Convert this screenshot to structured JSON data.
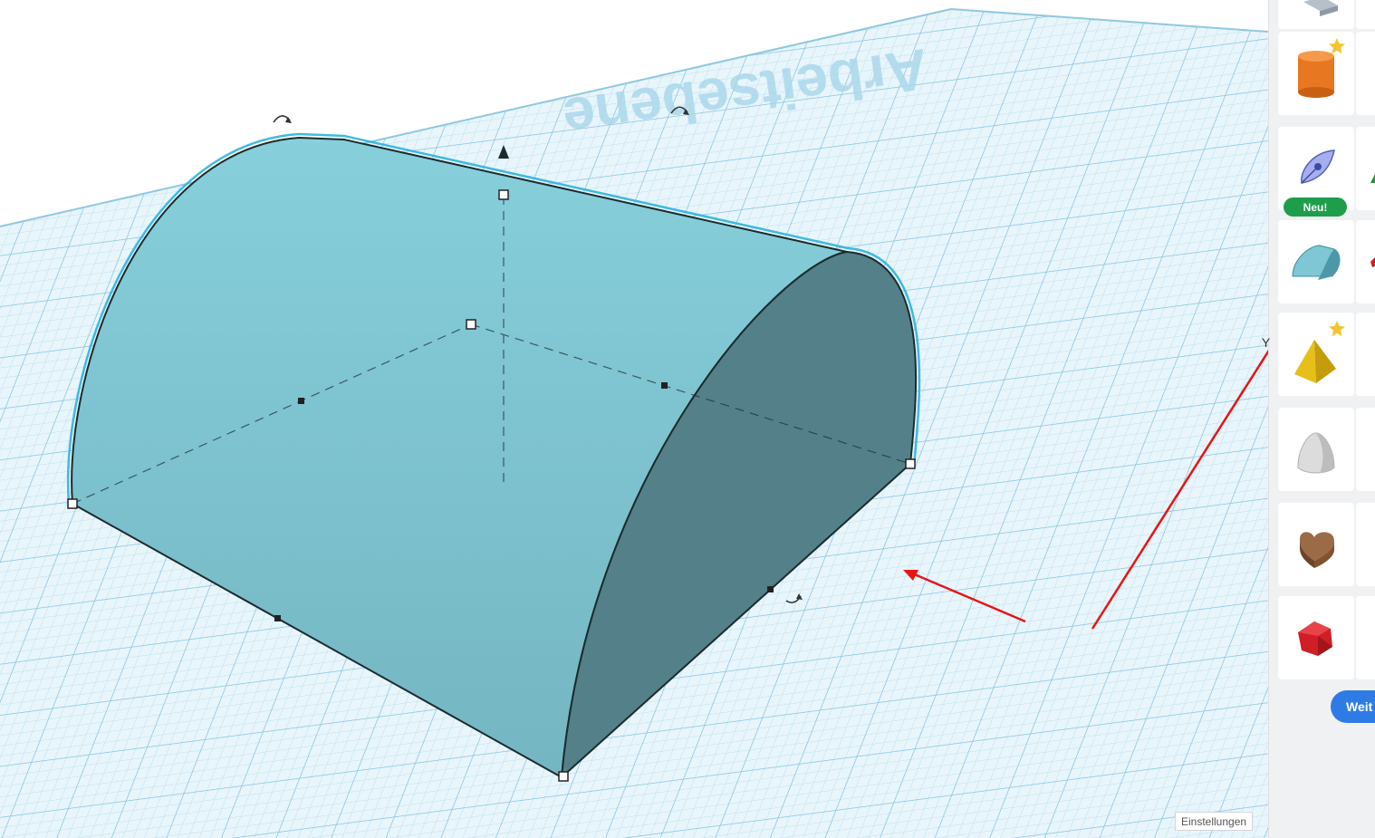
{
  "workplane": {
    "watermark": "Arbeitsebene",
    "grid_color": "#bfe3f2",
    "background": "#e8f5fb",
    "shape": {
      "name": "Halbzylinder",
      "color": "#7fc7d4",
      "end_color": "#548189",
      "outline_color": "#2bb3dd"
    }
  },
  "sidebar": {
    "shapes": [
      {
        "icon": "box-icon",
        "color": "#9aa5b1"
      },
      {
        "icon": "cylinder-icon",
        "color": "#e87722",
        "starred": true
      },
      {
        "icon": "scribble-pen-icon",
        "color": "#8892d8",
        "badge": "Neu!"
      },
      {
        "icon": "half-cylinder-icon",
        "color": "#5bb3c8"
      },
      {
        "icon": "pyramid-icon",
        "color": "#e6c019",
        "starred": true
      },
      {
        "icon": "paraboloid-icon",
        "color": "#cccccc"
      },
      {
        "icon": "heart-icon",
        "color": "#8b5a3c"
      },
      {
        "icon": "polyhedron-icon",
        "color": "#d01d26"
      }
    ],
    "more_button": "Weit",
    "edge_tab": "Y"
  },
  "footer": {
    "settings_label": "Einstellungen"
  },
  "annotations": {
    "arrow_color": "#e51515"
  }
}
